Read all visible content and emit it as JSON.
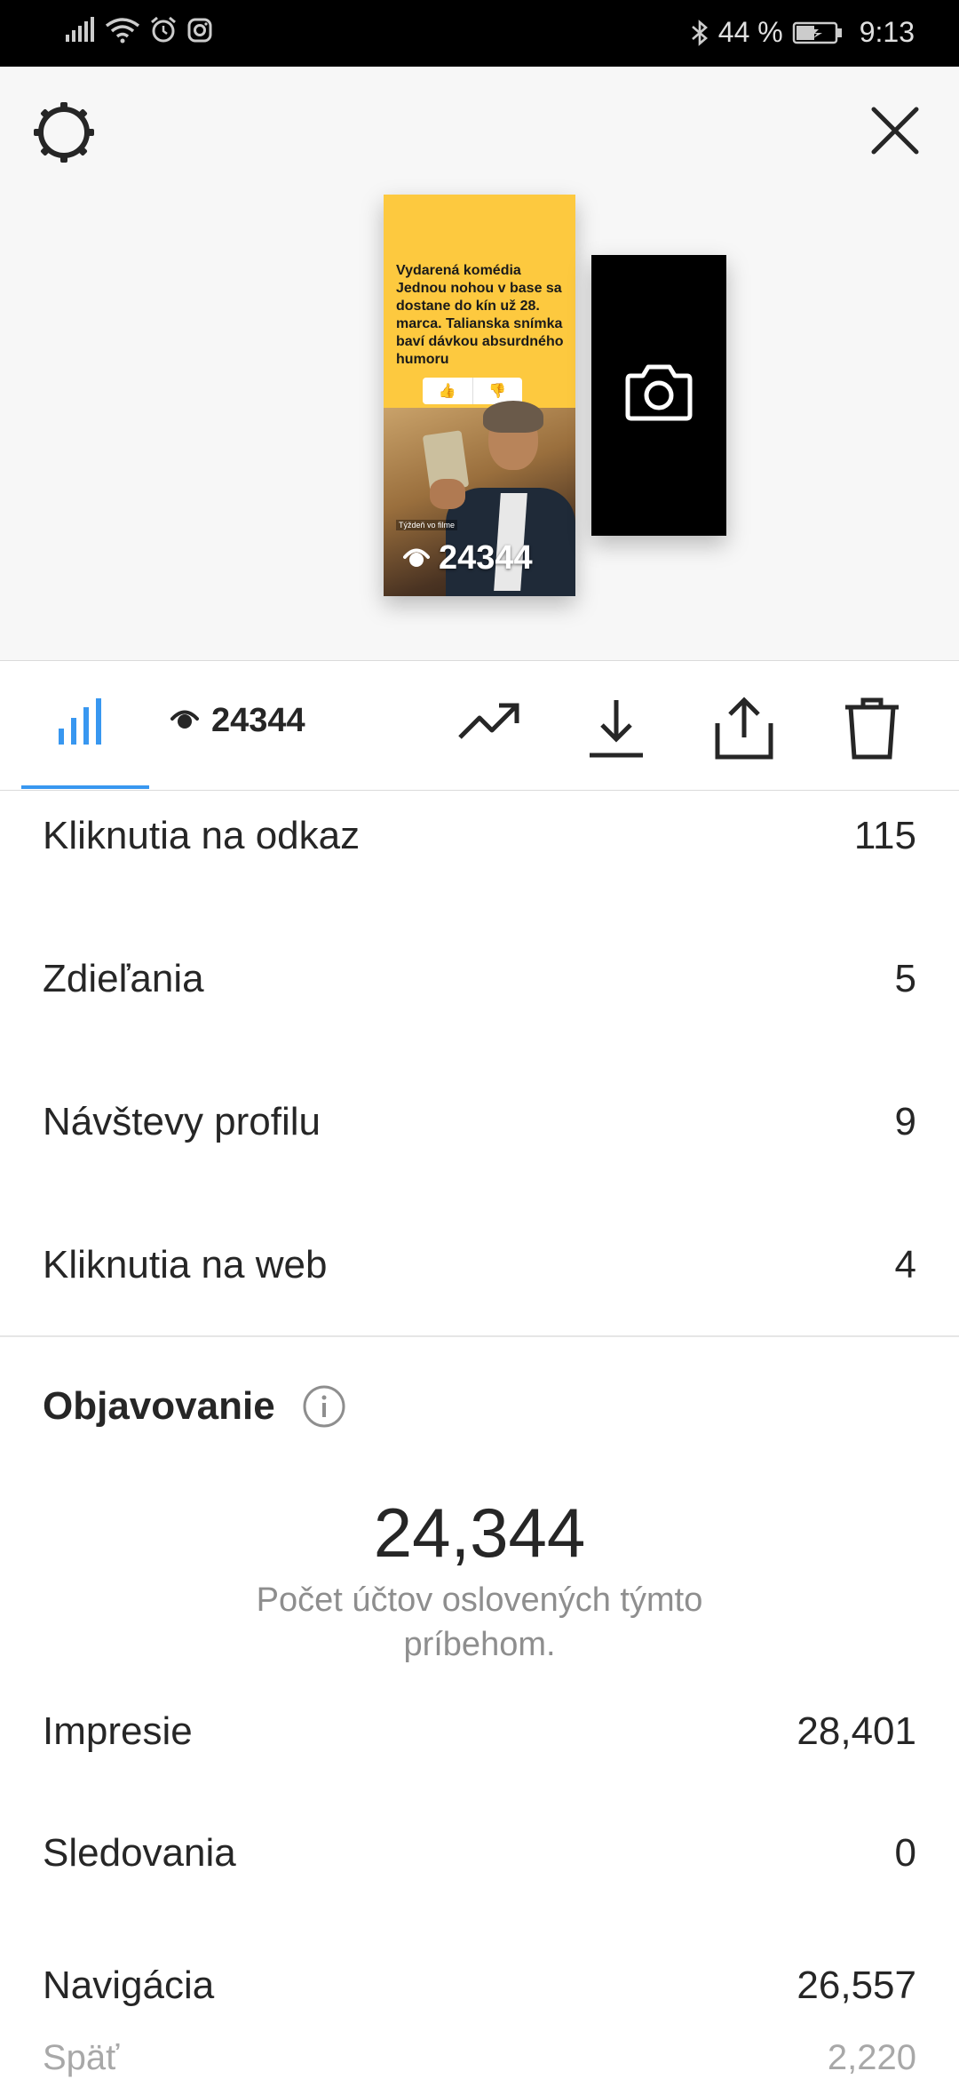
{
  "status_bar": {
    "battery": "44 %",
    "time": "9:13"
  },
  "story": {
    "headline": "Vydarená komédia Jednou nohou v base sa dostane do kín už 28. marca. Talianska snímka baví dávkou absurdného humoru",
    "vote_up": "👍",
    "vote_down": "👎",
    "tag": "Týždeň vo filme",
    "views": "24344"
  },
  "toolbar": {
    "viewers_count": "24344"
  },
  "interactions": [
    {
      "label": "Kliknutia na odkaz",
      "value": "115"
    },
    {
      "label": "Zdieľania",
      "value": "5"
    },
    {
      "label": "Návštevy profilu",
      "value": "9"
    },
    {
      "label": "Kliknutia na web",
      "value": "4"
    }
  ],
  "discovery": {
    "title": "Objavovanie",
    "reach": "24,344",
    "reach_caption": "Počet účtov oslovených týmto príbehom.",
    "rows": [
      {
        "label": "Impresie",
        "value": "28,401"
      },
      {
        "label": "Sledovania",
        "value": "0"
      },
      {
        "label": "Navigácia",
        "value": "26,557"
      },
      {
        "label": "Späť",
        "value": "2,220"
      }
    ]
  },
  "colors": {
    "accent": "#3897f0",
    "story_yellow": "#fdc93f",
    "muted_text": "#8e8e8e"
  },
  "icons": [
    "gear-icon",
    "close-icon",
    "camera-icon",
    "bar-chart-icon",
    "eye-icon",
    "trend-icon",
    "download-icon",
    "share-icon",
    "trash-icon",
    "info-icon"
  ]
}
